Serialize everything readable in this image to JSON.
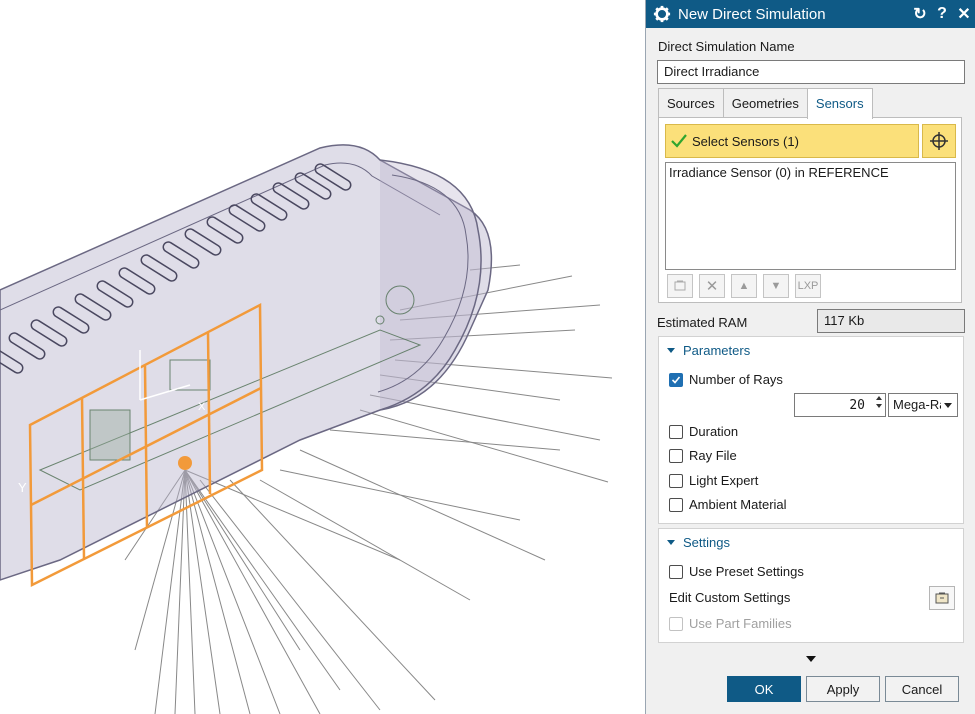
{
  "dialog": {
    "title": "New Direct Simulation",
    "name_label": "Direct Simulation Name",
    "name_value": "Direct Irradiance",
    "tabs": [
      {
        "label": "Sources"
      },
      {
        "label": "Geometries"
      },
      {
        "label": "Sensors",
        "active": true
      }
    ],
    "sensors": {
      "select_label": "Select Sensors (1)",
      "items": [
        "Irradiance Sensor (0) in REFERENCE"
      ],
      "tools": [
        "LXP"
      ]
    },
    "ram": {
      "label": "Estimated RAM",
      "value": "117 Kb"
    },
    "parameters": {
      "heading": "Parameters",
      "number_of_rays": {
        "label": "Number of Rays",
        "checked": true,
        "value": "20",
        "unit": "Mega-Rays"
      },
      "duration": {
        "label": "Duration",
        "checked": false
      },
      "ray_file": {
        "label": "Ray File",
        "checked": false
      },
      "light_expert": {
        "label": "Light Expert",
        "checked": false
      },
      "ambient_material": {
        "label": "Ambient Material",
        "checked": false
      }
    },
    "settings": {
      "heading": "Settings",
      "use_preset": {
        "label": "Use Preset Settings",
        "checked": false
      },
      "edit_custom": "Edit Custom Settings",
      "use_part_families": {
        "label": "Use Part Families",
        "checked": false,
        "disabled": true
      }
    },
    "buttons": {
      "ok": "OK",
      "apply": "Apply",
      "cancel": "Cancel"
    }
  },
  "colors": {
    "titlebar": "#0f5a86",
    "selection_highlight": "#fbe07a",
    "sensor_outline": "#f29a3a"
  }
}
